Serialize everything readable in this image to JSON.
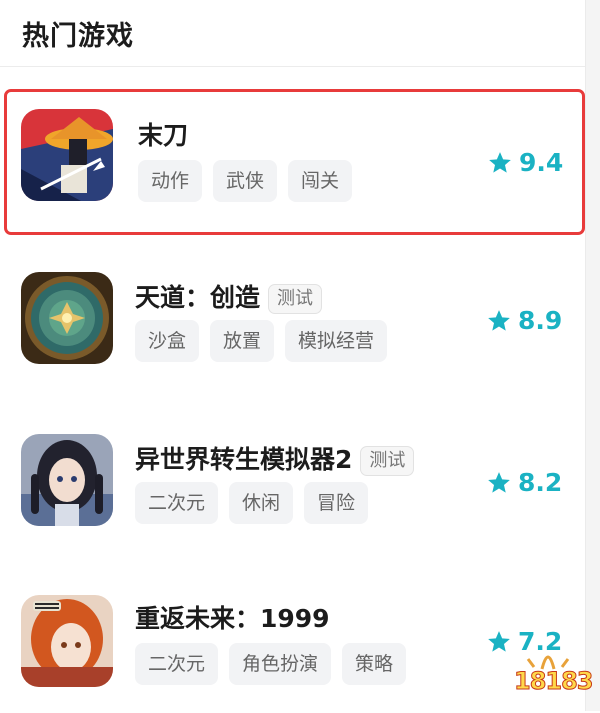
{
  "header": {
    "title": "热门游戏"
  },
  "games": [
    {
      "name": "末刀",
      "badge": "",
      "tags": [
        "动作",
        "武侠",
        "闯关"
      ],
      "rating": "9.4",
      "icon": "samurai-game-icon"
    },
    {
      "name": "天道：创造",
      "badge": "测试",
      "tags": [
        "沙盒",
        "放置",
        "模拟经营"
      ],
      "rating": "8.9",
      "icon": "compass-mandala-icon"
    },
    {
      "name": "异世界转生模拟器2",
      "badge": "测试",
      "tags": [
        "二次元",
        "休闲",
        "冒险"
      ],
      "rating": "8.2",
      "icon": "anime-girl-icon"
    },
    {
      "name": "重返未来：1999",
      "badge": "",
      "tags": [
        "二次元",
        "角色扮演",
        "策略"
      ],
      "rating": "7.2",
      "icon": "anime-redhead-icon"
    }
  ],
  "watermark": {
    "text": "18183",
    "icon": "18183-logo"
  },
  "colors": {
    "rating": "#1ab2c3",
    "highlight_border": "#e83b3b",
    "tag_bg": "#f2f3f5"
  }
}
